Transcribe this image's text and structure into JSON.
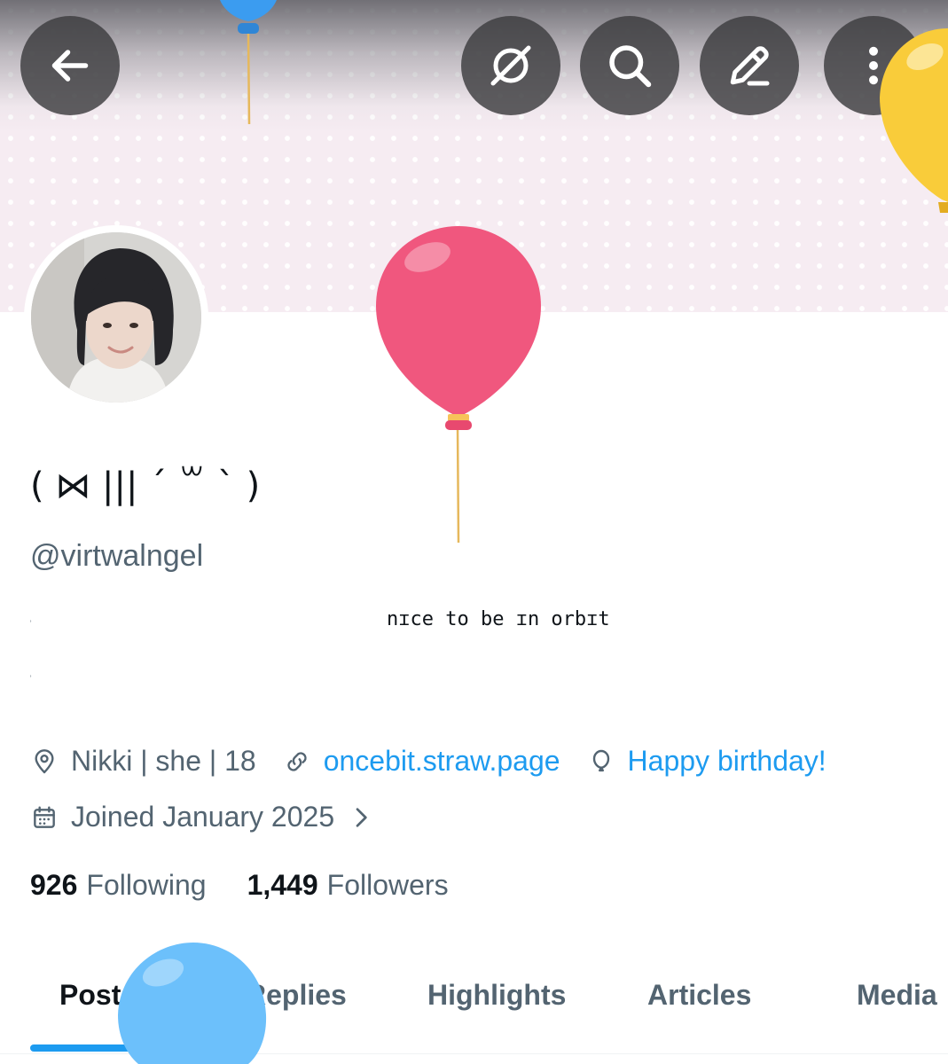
{
  "header": {
    "back_icon": "arrow-left-icon",
    "grok_icon": "grok-icon",
    "search_icon": "search-icon",
    "edit_icon": "pencil-icon",
    "more_icon": "more-vertical-icon"
  },
  "profile": {
    "display_name": "( ⋈ ||| ´ ꒳ ` )",
    "handle": "@virtwalngel",
    "bio": {
      "marker_1": "˒",
      "text": "nɪce to be ɪn orbɪt",
      "marker_2": "˒"
    },
    "meta": {
      "location": "Nikki | she | 18",
      "website": "oncebit.straw.page",
      "birthday": "Happy birthday!",
      "joined": "Joined January 2025"
    },
    "stats": {
      "following_count": "926",
      "following_label": "Following",
      "followers_count": "1,449",
      "followers_label": "Followers"
    }
  },
  "tabs": [
    "Posts",
    "Replies",
    "Highlights",
    "Articles",
    "Media"
  ],
  "active_tab": "Posts",
  "colors": {
    "accent": "#1d9bf0",
    "text_primary": "#0f1419",
    "text_secondary": "#536471",
    "balloon_pink": "#f0577e",
    "balloon_yellow": "#f9cc3a",
    "balloon_blue": "#6cc0fb"
  }
}
